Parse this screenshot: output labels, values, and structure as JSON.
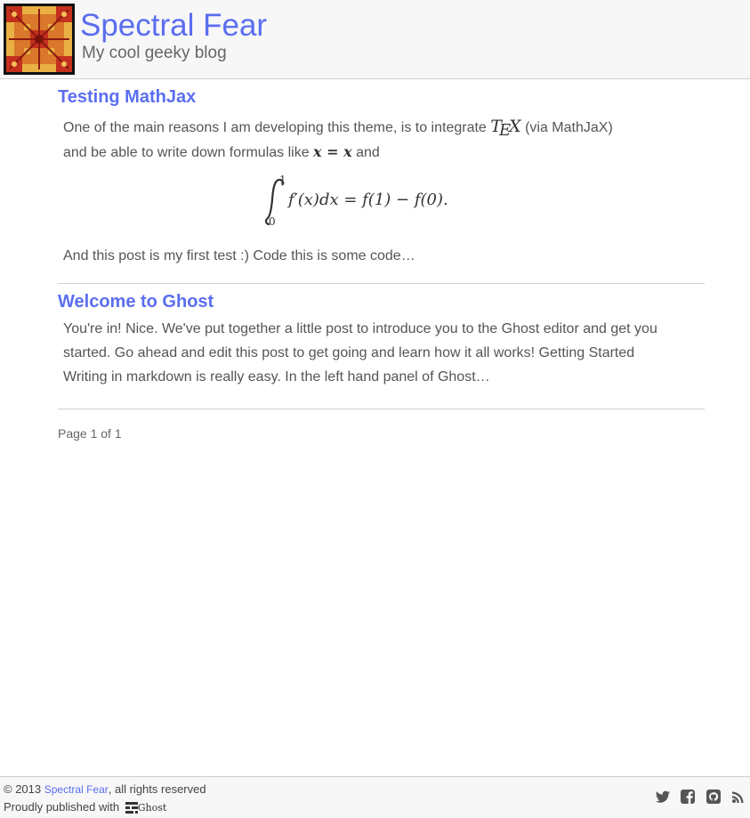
{
  "header": {
    "title": "Spectral Fear",
    "description": "My cool geeky blog"
  },
  "posts": [
    {
      "title": "Testing MathJax",
      "excerpt_part1": "One of the main reasons I am developing this theme, is to integrate ",
      "tex_t": "T",
      "tex_e": "E",
      "tex_x": "X",
      "excerpt_part2": " (via MathJaX)",
      "excerpt_part3": "and be able to write down formulas like ",
      "inline_formula": "x = x",
      "excerpt_part4": " and",
      "display_formula": {
        "integral_upper": "1",
        "integral_lower": "0",
        "integrand": "f′(x)dx = f(1) − f(0)."
      },
      "excerpt_tail": "And this post is my first test :) Code this is some code…"
    },
    {
      "title": "Welcome to Ghost",
      "excerpt": "You're in! Nice. We've put together a little post to introduce you to the Ghost editor and get you started. Go ahead and edit this post to get going and learn how it all works! Getting Started Writing in markdown is really easy. In the left hand panel of Ghost…"
    }
  ],
  "pagination": "Page 1 of 1",
  "footer": {
    "copyright_prefix": "© 2013 ",
    "copyright_link": "Spectral Fear",
    "copyright_suffix": ", all rights reserved",
    "published": "Proudly published with ",
    "ghost_word": "Ghost"
  },
  "social_icons": [
    "twitter-icon",
    "facebook-icon",
    "github-icon",
    "rss-icon"
  ],
  "colors": {
    "accent": "#5b6ef0",
    "text": "#555555",
    "header_bg": "#f7f7f7",
    "divider": "#cfcfcf",
    "icon": "#555555"
  }
}
